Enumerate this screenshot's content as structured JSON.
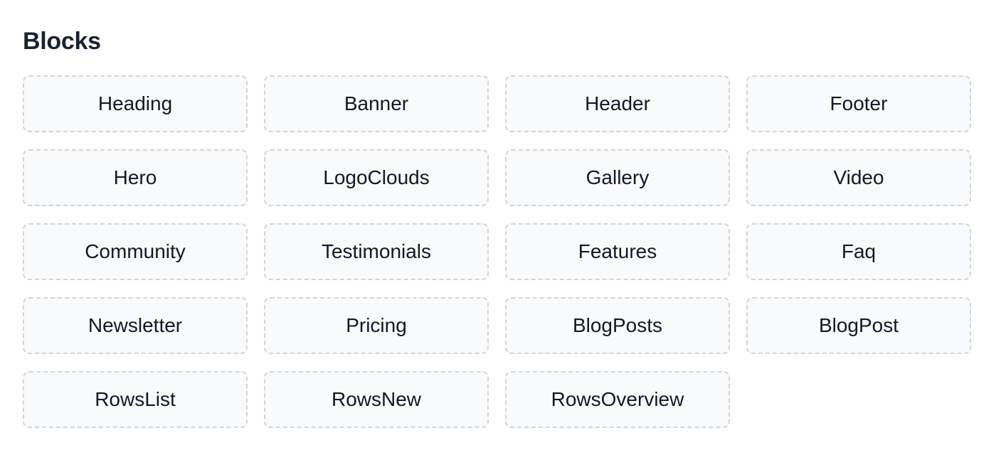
{
  "section": {
    "title": "Blocks"
  },
  "blocks": [
    {
      "label": "Heading"
    },
    {
      "label": "Banner"
    },
    {
      "label": "Header"
    },
    {
      "label": "Footer"
    },
    {
      "label": "Hero"
    },
    {
      "label": "LogoClouds"
    },
    {
      "label": "Gallery"
    },
    {
      "label": "Video"
    },
    {
      "label": "Community"
    },
    {
      "label": "Testimonials"
    },
    {
      "label": "Features"
    },
    {
      "label": "Faq"
    },
    {
      "label": "Newsletter"
    },
    {
      "label": "Pricing"
    },
    {
      "label": "BlogPosts"
    },
    {
      "label": "BlogPost"
    },
    {
      "label": "RowsList"
    },
    {
      "label": "RowsNew"
    },
    {
      "label": "RowsOverview"
    }
  ]
}
